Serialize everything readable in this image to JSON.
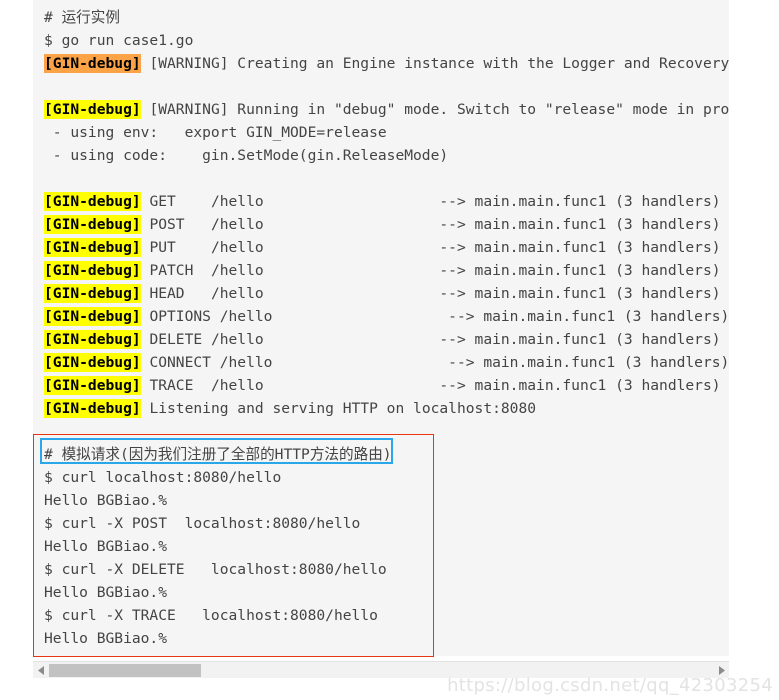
{
  "page": {
    "background_color": "#ffffff",
    "code_background_color": "#f5f5f5",
    "text_color": "#444444"
  },
  "highlight_colors": {
    "yellow": "#ffff00",
    "orange": "#fba346",
    "red_box": "#e8360f",
    "cyan_box": "#29a7e8"
  },
  "terminal": {
    "lines": [
      {
        "id": "l01",
        "tag": "",
        "tag_style": "none",
        "rest": "# 运行实例"
      },
      {
        "id": "l02",
        "tag": "",
        "tag_style": "none",
        "rest": "$ go run case1.go"
      },
      {
        "id": "l03",
        "tag": "[GIN-debug]",
        "tag_style": "orange",
        "rest": " [WARNING] Creating an Engine instance with the Logger and Recovery middlew"
      },
      {
        "id": "l04",
        "tag": "",
        "tag_style": "none",
        "rest": " "
      },
      {
        "id": "l05",
        "tag": "[GIN-debug]",
        "tag_style": "yellow",
        "rest": " [WARNING] Running in \"debug\" mode. Switch to \"release\" mode in production."
      },
      {
        "id": "l06",
        "tag": "",
        "tag_style": "none",
        "rest": " - using env:   export GIN_MODE=release"
      },
      {
        "id": "l07",
        "tag": "",
        "tag_style": "none",
        "rest": " - using code:    gin.SetMode(gin.ReleaseMode)"
      },
      {
        "id": "l08",
        "tag": "",
        "tag_style": "none",
        "rest": " "
      },
      {
        "id": "l09",
        "tag": "[GIN-debug]",
        "tag_style": "yellow",
        "rest": " GET    /hello                    --> main.main.func1 (3 handlers)"
      },
      {
        "id": "l10",
        "tag": "[GIN-debug]",
        "tag_style": "yellow",
        "rest": " POST   /hello                    --> main.main.func1 (3 handlers)"
      },
      {
        "id": "l11",
        "tag": "[GIN-debug]",
        "tag_style": "yellow",
        "rest": " PUT    /hello                    --> main.main.func1 (3 handlers)"
      },
      {
        "id": "l12",
        "tag": "[GIN-debug]",
        "tag_style": "yellow",
        "rest": " PATCH  /hello                    --> main.main.func1 (3 handlers)"
      },
      {
        "id": "l13",
        "tag": "[GIN-debug]",
        "tag_style": "yellow",
        "rest": " HEAD   /hello                    --> main.main.func1 (3 handlers)"
      },
      {
        "id": "l14",
        "tag": "[GIN-debug]",
        "tag_style": "yellow",
        "rest": " OPTIONS /hello                    --> main.main.func1 (3 handlers)"
      },
      {
        "id": "l15",
        "tag": "[GIN-debug]",
        "tag_style": "yellow",
        "rest": " DELETE /hello                    --> main.main.func1 (3 handlers)"
      },
      {
        "id": "l16",
        "tag": "[GIN-debug]",
        "tag_style": "yellow",
        "rest": " CONNECT /hello                    --> main.main.func1 (3 handlers)"
      },
      {
        "id": "l17",
        "tag": "[GIN-debug]",
        "tag_style": "yellow",
        "rest": " TRACE  /hello                    --> main.main.func1 (3 handlers)"
      },
      {
        "id": "l18",
        "tag": "[GIN-debug]",
        "tag_style": "yellow",
        "rest": " Listening and serving HTTP on localhost:8080"
      },
      {
        "id": "l19",
        "tag": "",
        "tag_style": "none",
        "rest": " "
      },
      {
        "id": "l20",
        "tag": "",
        "tag_style": "none",
        "rest": "# 模拟请求(因为我们注册了全部的HTTP方法的路由)"
      },
      {
        "id": "l21",
        "tag": "",
        "tag_style": "none",
        "rest": "$ curl localhost:8080/hello"
      },
      {
        "id": "l22",
        "tag": "",
        "tag_style": "none",
        "rest": "Hello BGBiao.%"
      },
      {
        "id": "l23",
        "tag": "",
        "tag_style": "none",
        "rest": "$ curl -X POST  localhost:8080/hello"
      },
      {
        "id": "l24",
        "tag": "",
        "tag_style": "none",
        "rest": "Hello BGBiao.%"
      },
      {
        "id": "l25",
        "tag": "",
        "tag_style": "none",
        "rest": "$ curl -X DELETE   localhost:8080/hello"
      },
      {
        "id": "l26",
        "tag": "",
        "tag_style": "none",
        "rest": "Hello BGBiao.%"
      },
      {
        "id": "l27",
        "tag": "",
        "tag_style": "none",
        "rest": "$ curl -X TRACE   localhost:8080/hello"
      },
      {
        "id": "l28",
        "tag": "",
        "tag_style": "none",
        "rest": "Hello BGBiao.%"
      }
    ]
  },
  "annotations": {
    "red_box_label": "curl-requests-annotation-box",
    "cyan_box_label": "simulated-request-comment-box"
  },
  "scrollbar": {
    "left_arrow_icon": "triangle-left-icon",
    "right_arrow_icon": "triangle-right-icon",
    "orientation": "horizontal"
  },
  "watermark": {
    "text": "https://blog.csdn.net/qq_42303254"
  }
}
